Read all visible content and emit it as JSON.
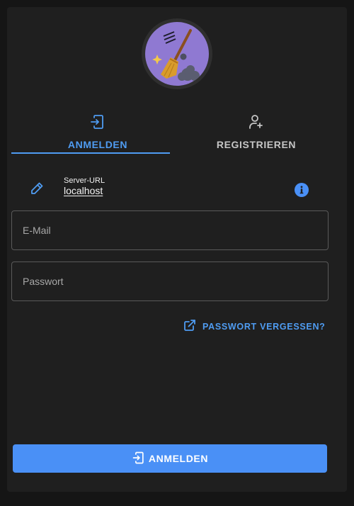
{
  "logo": {
    "icon": "broom-icon"
  },
  "tabs": [
    {
      "label": "ANMELDEN",
      "icon": "login-icon",
      "active": true
    },
    {
      "label": "REGISTRIEREN",
      "icon": "add-user-icon",
      "active": false
    }
  ],
  "server": {
    "caption": "Server-URL",
    "value": "localhost",
    "edit_icon": "pencil-icon",
    "info_icon": "info-icon"
  },
  "form": {
    "email_placeholder": "E-Mail",
    "email_value": "",
    "password_placeholder": "Passwort",
    "password_value": ""
  },
  "forgot": {
    "label": "PASSWORT VERGESSEN?",
    "icon": "external-link-icon"
  },
  "submit": {
    "label": "ANMELDEN",
    "icon": "login-icon"
  },
  "colors": {
    "accent": "#4f9cf2",
    "button": "#4a90f6",
    "card": "#1f1f1f",
    "background": "#151515",
    "logo_bg": "#8f79d2"
  }
}
